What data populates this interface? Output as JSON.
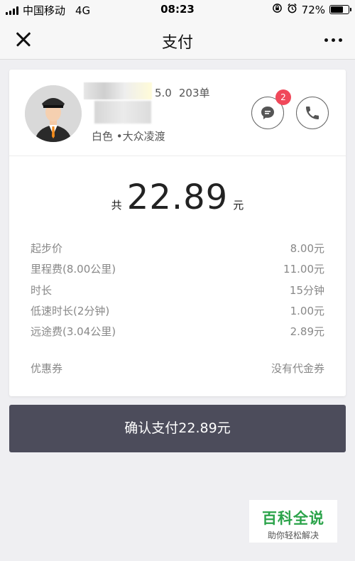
{
  "status_bar": {
    "carrier": "中国移动",
    "network": "4G",
    "time": "08:23",
    "battery": "72%",
    "battery_level": 0.72
  },
  "nav": {
    "title": "支付",
    "close_icon": "close-icon",
    "more_icon": "more-icon"
  },
  "driver": {
    "rating": "5.0",
    "trips": "203单",
    "car": "白色 •大众凌渡",
    "message_badge": "2",
    "message_icon": "chat-bubble-icon",
    "call_icon": "phone-icon"
  },
  "total": {
    "prefix": "共",
    "amount": "22.89",
    "unit": "元"
  },
  "fees": [
    {
      "label": "起步价",
      "value": "8.00元"
    },
    {
      "label": "里程费(8.00公里)",
      "value": "11.00元"
    },
    {
      "label": "时长",
      "value": "15分钟"
    },
    {
      "label": "低速时长(2分钟)",
      "value": "1.00元"
    },
    {
      "label": "远途费(3.04公里)",
      "value": "2.89元"
    }
  ],
  "coupon": {
    "label": "优惠券",
    "value": "没有代金券"
  },
  "pay_button": "确认支付22.89元",
  "watermark": {
    "title": "百科全说",
    "subtitle": "助你轻松解决"
  },
  "colors": {
    "accent": "#4c4c5b",
    "badge": "#f0485a",
    "watermark_green": "#2ba34a"
  }
}
